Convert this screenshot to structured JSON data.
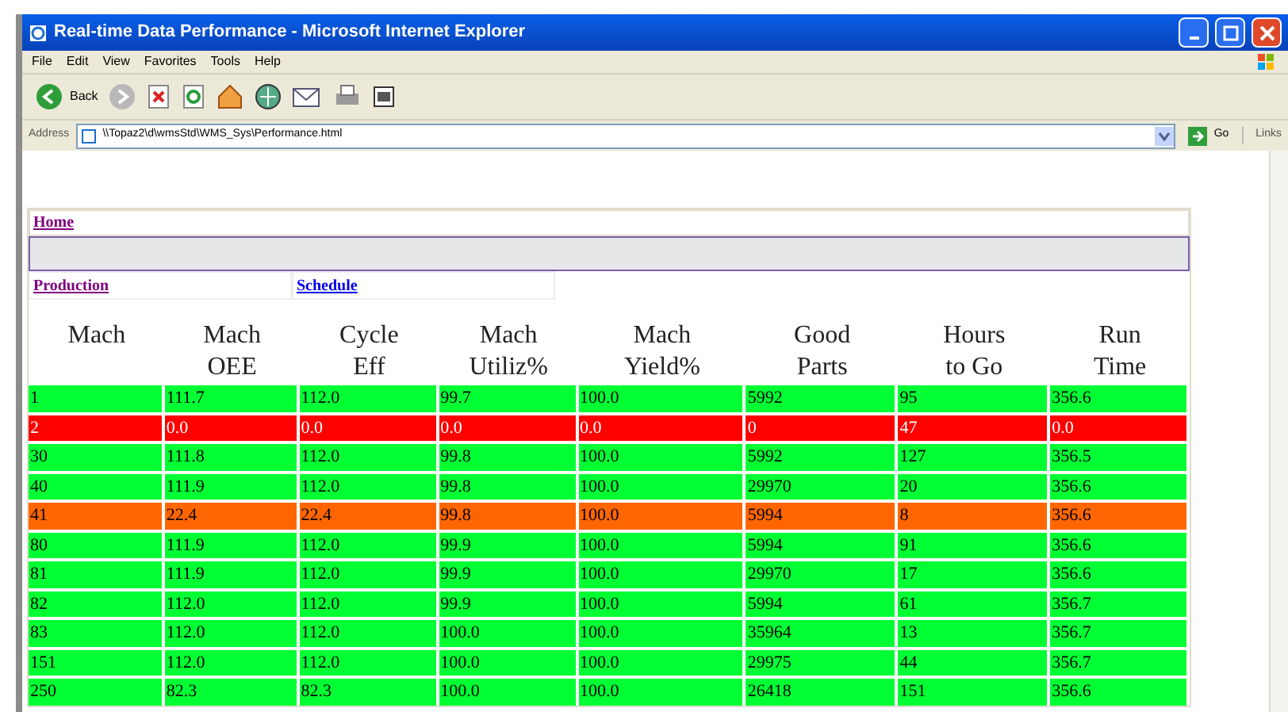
{
  "window": {
    "title": "Real-time Data Performance - Microsoft Internet Explorer"
  },
  "menu": [
    "File",
    "Edit",
    "View",
    "Favorites",
    "Tools",
    "Help"
  ],
  "toolbar": {
    "back": "Back"
  },
  "address": {
    "label": "Address",
    "value": "\\\\Topaz2\\d\\wmsStd\\WMS_Sys\\Performance.html",
    "go": "Go",
    "links": "Links"
  },
  "nav": {
    "home": "Home",
    "links": [
      "Production",
      "Schedule"
    ]
  },
  "table": {
    "columns": [
      "Mach",
      "Mach\nOEE",
      "Cycle\nEff",
      "Mach\nUtiliz%",
      "Mach\nYield%",
      "Good\nParts",
      "Hours\nto Go",
      "Run\nTime"
    ],
    "rows": [
      {
        "color": "#00ff33",
        "cells": [
          "1",
          "111.7",
          "112.0",
          "99.7",
          "100.0",
          "5992",
          "95",
          "356.6"
        ]
      },
      {
        "color": "#ff0000",
        "cells": [
          "2",
          "0.0",
          "0.0",
          "0.0",
          "0.0",
          "0",
          "47",
          "0.0"
        ]
      },
      {
        "color": "#00ff33",
        "cells": [
          "30",
          "111.8",
          "112.0",
          "99.8",
          "100.0",
          "5992",
          "127",
          "356.5"
        ]
      },
      {
        "color": "#00ff33",
        "cells": [
          "40",
          "111.9",
          "112.0",
          "99.8",
          "100.0",
          "29970",
          "20",
          "356.6"
        ]
      },
      {
        "color": "#ff6600",
        "cells": [
          "41",
          "22.4",
          "22.4",
          "99.8",
          "100.0",
          "5994",
          "8",
          "356.6"
        ]
      },
      {
        "color": "#00ff33",
        "cells": [
          "80",
          "111.9",
          "112.0",
          "99.9",
          "100.0",
          "5994",
          "91",
          "356.6"
        ]
      },
      {
        "color": "#00ff33",
        "cells": [
          "81",
          "111.9",
          "112.0",
          "99.9",
          "100.0",
          "29970",
          "17",
          "356.6"
        ]
      },
      {
        "color": "#00ff33",
        "cells": [
          "82",
          "112.0",
          "112.0",
          "99.9",
          "100.0",
          "5994",
          "61",
          "356.7"
        ]
      },
      {
        "color": "#00ff33",
        "cells": [
          "83",
          "112.0",
          "112.0",
          "100.0",
          "100.0",
          "35964",
          "13",
          "356.7"
        ]
      },
      {
        "color": "#00ff33",
        "cells": [
          "151",
          "112.0",
          "112.0",
          "100.0",
          "100.0",
          "29975",
          "44",
          "356.7"
        ]
      },
      {
        "color": "#00ff33",
        "cells": [
          "250",
          "82.3",
          "82.3",
          "100.0",
          "100.0",
          "26418",
          "151",
          "356.6"
        ]
      }
    ]
  }
}
